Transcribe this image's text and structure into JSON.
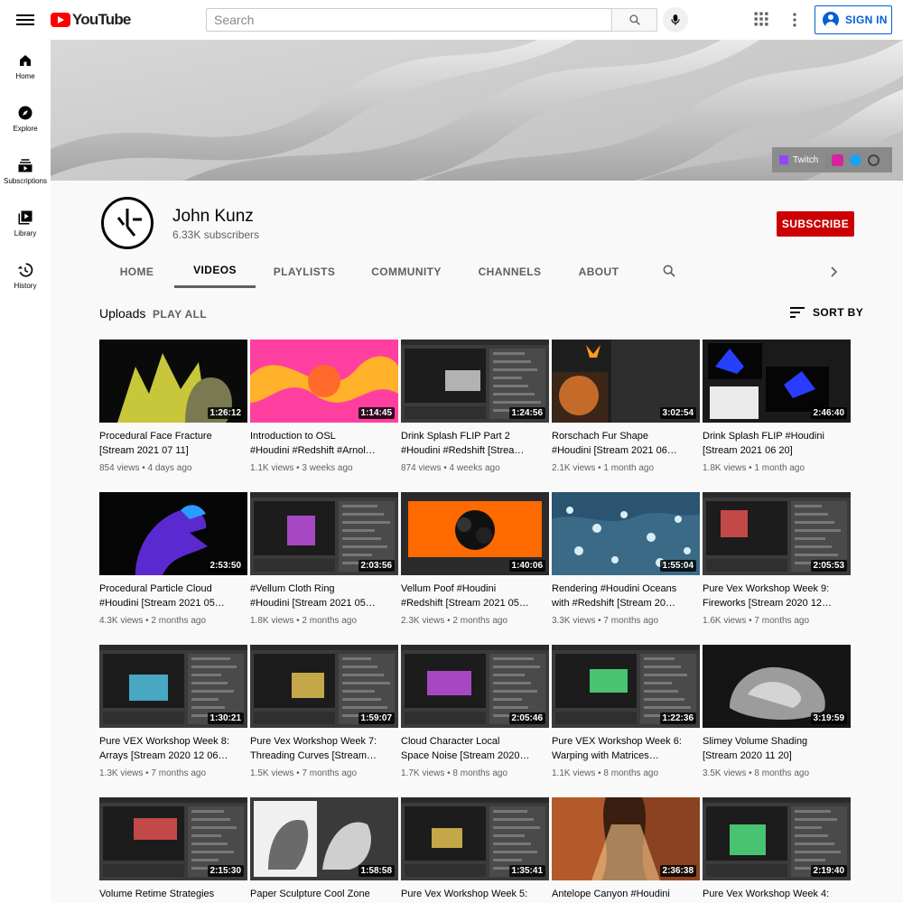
{
  "header": {
    "logo_text": "YouTube",
    "search_placeholder": "Search",
    "signin_label": "SIGN IN"
  },
  "rail": [
    {
      "label": "Home",
      "icon": "home-icon"
    },
    {
      "label": "Explore",
      "icon": "compass-icon"
    },
    {
      "label": "Subscriptions",
      "icon": "subscriptions-icon"
    },
    {
      "label": "Library",
      "icon": "library-icon"
    },
    {
      "label": "History",
      "icon": "history-icon"
    }
  ],
  "banner": {
    "twitch_label": "Twitch"
  },
  "channel": {
    "name": "John Kunz",
    "subscribers": "6.33K subscribers",
    "subscribe_label": "SUBSCRIBE"
  },
  "tabs": [
    "HOME",
    "VIDEOS",
    "PLAYLISTS",
    "COMMUNITY",
    "CHANNELS",
    "ABOUT"
  ],
  "active_tab": "VIDEOS",
  "section": {
    "title": "Uploads",
    "play_all": "PLAY ALL",
    "sort_by": "SORT BY"
  },
  "videos": [
    {
      "title1": "Procedural Face Fracture",
      "title2": "[Stream 2021 07 11]",
      "duration": "1:26:12",
      "views": "854 views",
      "age": "4 days ago",
      "theme": "face"
    },
    {
      "title1": "Introduction to OSL",
      "title2": "#Houdini #Redshift #Arnol…",
      "duration": "1:14:45",
      "views": "1.1K views",
      "age": "3 weeks ago",
      "theme": "swirl"
    },
    {
      "title1": "Drink Splash FLIP Part 2",
      "title2": "#Houdini #Redshift [Strea…",
      "duration": "1:24:56",
      "views": "874 views",
      "age": "4 weeks ago",
      "theme": "ui"
    },
    {
      "title1": "Rorschach Fur Shape",
      "title2": "#Houdini [Stream 2021 06…",
      "duration": "3:02:54",
      "views": "2.1K views",
      "age": "1 month ago",
      "theme": "fire"
    },
    {
      "title1": "Drink Splash FLIP #Houdini",
      "title2": "[Stream 2021 06 20]",
      "duration": "2:46:40",
      "views": "1.8K views",
      "age": "1 month ago",
      "theme": "blue"
    },
    {
      "title1": "Procedural Particle Cloud",
      "title2": "#Houdini [Stream 2021 05…",
      "duration": "2:53:50",
      "views": "4.3K views",
      "age": "2 months ago",
      "theme": "horse"
    },
    {
      "title1": "#Vellum Cloth Ring",
      "title2": "#Houdini [Stream 2021 05…",
      "duration": "2:03:56",
      "views": "1.8K views",
      "age": "2 months ago",
      "theme": "ui"
    },
    {
      "title1": "Vellum Poof #Houdini",
      "title2": "#Redshift [Stream 2021 05…",
      "duration": "1:40:06",
      "views": "2.3K views",
      "age": "2 months ago",
      "theme": "orange"
    },
    {
      "title1": "Rendering #Houdini Oceans",
      "title2": "with #Redshift [Stream 20…",
      "duration": "1:55:04",
      "views": "3.3K views",
      "age": "7 months ago",
      "theme": "ocean"
    },
    {
      "title1": "Pure Vex Workshop Week 9:",
      "title2": "Fireworks [Stream 2020 12…",
      "duration": "2:05:53",
      "views": "1.6K views",
      "age": "7 months ago",
      "theme": "ui"
    },
    {
      "title1": "Pure VEX Workshop Week 8:",
      "title2": "Arrays [Stream 2020 12 06…",
      "duration": "1:30:21",
      "views": "1.3K views",
      "age": "7 months ago",
      "theme": "ui"
    },
    {
      "title1": "Pure Vex Workshop Week 7:",
      "title2": "Threading Curves [Stream…",
      "duration": "1:59:07",
      "views": "1.5K views",
      "age": "7 months ago",
      "theme": "ui"
    },
    {
      "title1": "Cloud Character Local",
      "title2": "Space Noise [Stream 2020…",
      "duration": "2:05:46",
      "views": "1.7K views",
      "age": "8 months ago",
      "theme": "ui"
    },
    {
      "title1": "Pure VEX Workshop Week 6:",
      "title2": "Warping with Matrices…",
      "duration": "1:22:36",
      "views": "1.1K views",
      "age": "8 months ago",
      "theme": "ui"
    },
    {
      "title1": "Slimey Volume Shading",
      "title2": "[Stream 2020 11 20]",
      "duration": "3:19:59",
      "views": "3.5K views",
      "age": "8 months ago",
      "theme": "rock"
    },
    {
      "title1": "Volume Retime Strategies",
      "title2": "",
      "duration": "2:15:30",
      "views": "",
      "age": "",
      "theme": "ui"
    },
    {
      "title1": "Paper Sculpture Cool Zone",
      "title2": "",
      "duration": "1:58:58",
      "views": "",
      "age": "",
      "theme": "paper"
    },
    {
      "title1": "Pure Vex Workshop Week 5:",
      "title2": "",
      "duration": "1:35:41",
      "views": "",
      "age": "",
      "theme": "ui"
    },
    {
      "title1": "Antelope Canyon #Houdini",
      "title2": "",
      "duration": "2:36:38",
      "views": "",
      "age": "",
      "theme": "canyon"
    },
    {
      "title1": "Pure Vex Workshop Week 4:",
      "title2": "",
      "duration": "2:19:40",
      "views": "",
      "age": "",
      "theme": "ui"
    }
  ],
  "colors": {
    "brand_red": "#ff0000",
    "subscribe_red": "#cc0000",
    "link_blue": "#065fd4"
  }
}
